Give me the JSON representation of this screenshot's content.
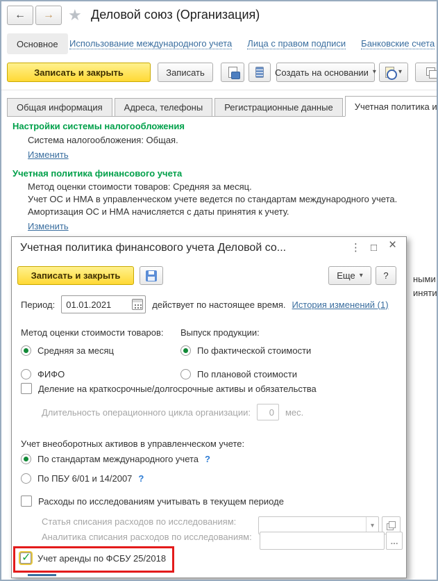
{
  "window": {
    "title": "Деловой союз (Организация)"
  },
  "icons": {
    "back": "←",
    "forward": "→",
    "star": "★",
    "dropdown": "▾",
    "kebab": "⋮",
    "maximize": "□",
    "close": "×",
    "help": "?",
    "ellipsis": "..."
  },
  "nav": {
    "active_label": "Основное",
    "links": [
      {
        "label": "Использование международного учета"
      },
      {
        "label": "Лица с правом подписи"
      },
      {
        "label": "Банковские счета"
      }
    ]
  },
  "toolbar": {
    "save_close_label": "Записать и закрыть",
    "save_label": "Записать",
    "create_based_label": "Создать на основании"
  },
  "tabs": [
    {
      "label": "Общая информация",
      "active": false
    },
    {
      "label": "Адреса, телефоны",
      "active": false
    },
    {
      "label": "Регистрационные данные",
      "active": false
    },
    {
      "label": "Учетная политика и налоги",
      "active": true
    }
  ],
  "content": {
    "tax": {
      "title": "Настройки системы налогообложения",
      "line1": "Система налогообложения: Общая.",
      "change_link": "Изменить"
    },
    "policy": {
      "title": "Учетная политика финансового учета",
      "line1": "Метод оценки стоимости товаров: Средняя за месяц.",
      "line2": "Учет ОС и НМА в управленческом учете ведется по стандартам международного учета.",
      "line3": "Амортизация ОС и НМА начисляется с даты принятия к учету.",
      "change_link": "Изменить"
    },
    "clipped": [
      "ными д",
      "инятия"
    ]
  },
  "modal": {
    "title": "Учетная политика финансового учета Деловой со...",
    "toolbar": {
      "save_close_label": "Записать и закрыть",
      "more_label": "Еще",
      "help_label": "?"
    },
    "period": {
      "label": "Период:",
      "value": "01.01.2021",
      "note": "действует по настоящее время.",
      "history_link": "История изменений (1)"
    },
    "valuation": {
      "label": "Метод оценки стоимости товаров:",
      "options": [
        {
          "label": "Средняя за месяц",
          "selected": true
        },
        {
          "label": "ФИФО",
          "selected": false
        }
      ]
    },
    "output": {
      "label": "Выпуск продукции:",
      "options": [
        {
          "label": "По фактической стоимости",
          "selected": true
        },
        {
          "label": "По плановой стоимости",
          "selected": false
        }
      ]
    },
    "division": {
      "label": "Деление на краткосрочные/долгосрочные активы и обязательства",
      "checked": false
    },
    "cycle": {
      "label": "Длительность операционного цикла организации:",
      "value": "0",
      "unit": "мес."
    },
    "noncurrent": {
      "label": "Учет внеоборотных активов в управленческом учете:",
      "help": "?",
      "options": [
        {
          "label": "По стандартам международного учета",
          "selected": true
        },
        {
          "label": "По ПБУ 6/01 и 14/2007",
          "selected": false
        }
      ]
    },
    "research": {
      "label": "Расходы по исследованиям учитывать в текущем периоде",
      "checked": false
    },
    "research_item": {
      "label": "Статья списания расходов по исследованиям:",
      "value": ""
    },
    "research_analytics": {
      "label": "Аналитика списания расходов по исследованиям:",
      "value": ""
    },
    "lease": {
      "label": "Учет аренды по ФСБУ 25/2018",
      "checked": true
    }
  },
  "colors": {
    "accent_yellow": "#FFD935",
    "link_blue": "#3A6E9F",
    "section_green": "#00A04A",
    "highlight_red": "#E31B1B",
    "check_green": "#18A53C"
  }
}
